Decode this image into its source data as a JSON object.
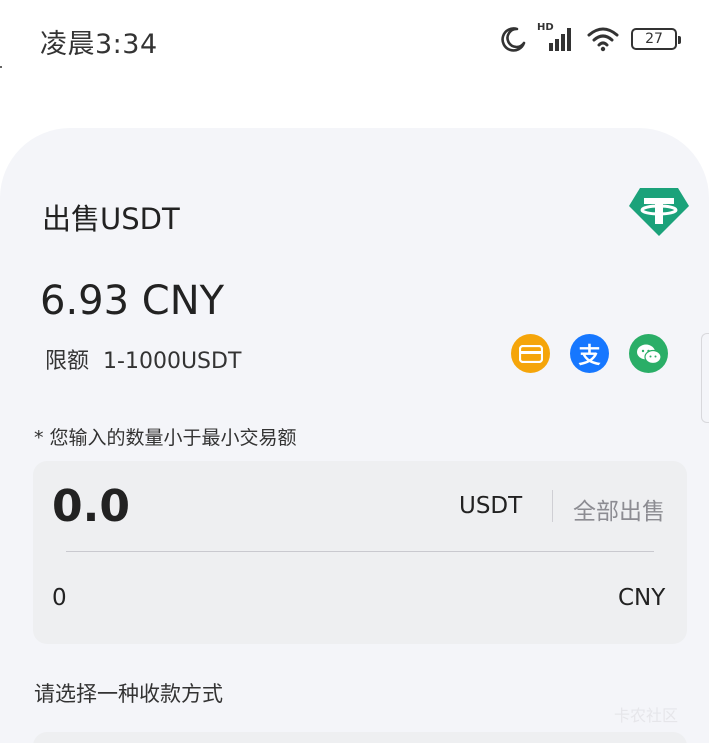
{
  "status_bar": {
    "time": "凌晨3:34",
    "network_badge": "HD",
    "battery": "27",
    "icons": [
      "moon-icon",
      "signal-icon",
      "wifi-icon",
      "battery-icon"
    ]
  },
  "sheet": {
    "title": "出售USDT",
    "logo": "tether-logo",
    "price": "6.93 CNY",
    "limit_label": "限额",
    "limit_value": "1-1000USDT",
    "payment_methods": [
      "bank-card-icon",
      "alipay-icon",
      "wechat-pay-icon"
    ],
    "alipay_glyph": "支",
    "warning": "* 您输入的数量小于最小交易额",
    "amount": {
      "value": "0.0",
      "unit": "USDT",
      "sell_all_label": "全部出售",
      "cny_value": "0",
      "cny_unit": "CNY"
    },
    "payment_section_label": "请选择一种收款方式",
    "watermark": "卡农社区"
  },
  "colors": {
    "sheet_bg": "#f4f5f9",
    "input_bg": "#eeeff1",
    "tether_green": "#1ba27a",
    "card_orange": "#f5a50a",
    "alipay_blue": "#1677ff",
    "wechat_green": "#2aae67"
  }
}
